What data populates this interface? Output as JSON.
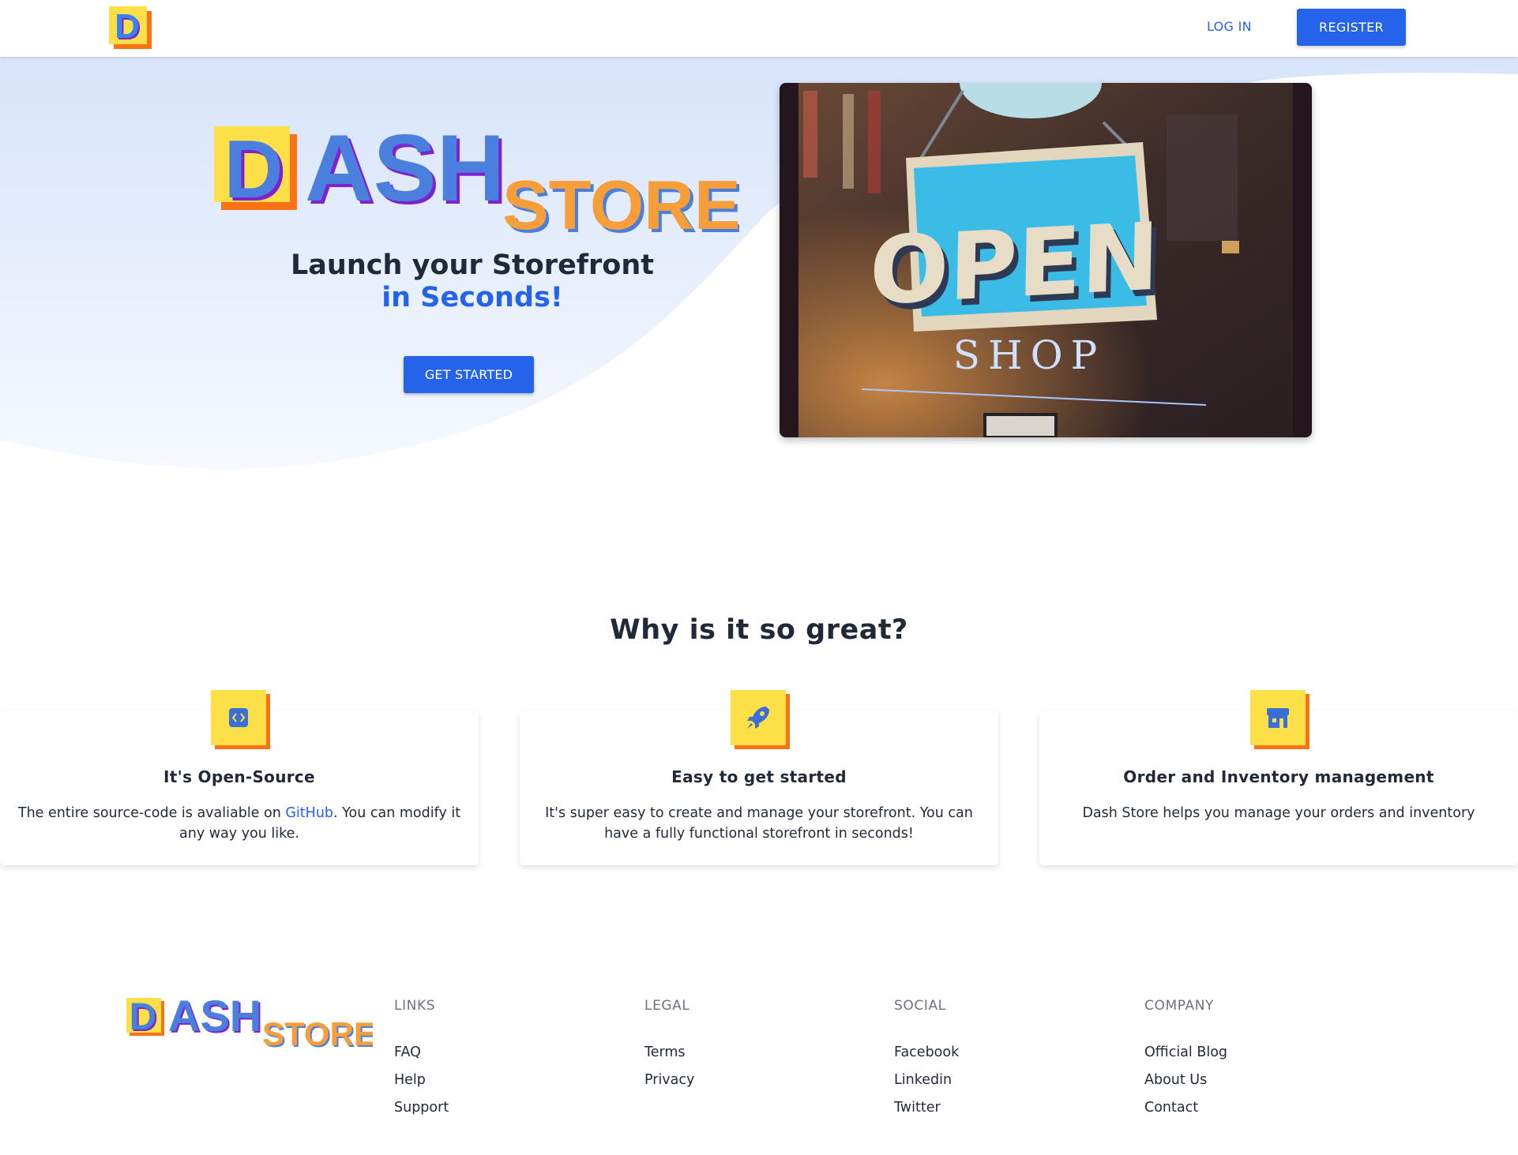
{
  "header": {
    "login_label": "LOG IN",
    "register_label": "REGISTER"
  },
  "logo": {
    "letter": "D",
    "dash_rest": "ASH",
    "store": "STORE"
  },
  "hero": {
    "title_line1": "Launch your Storefront",
    "title_line2": "in Seconds!",
    "cta_label": "GET STARTED",
    "photo_sign_word": "OPEN",
    "photo_sign_sub": "SHOP"
  },
  "features": {
    "title": "Why is it so great?",
    "cards": [
      {
        "icon": "code-icon",
        "title": "It's Open-Source",
        "text_before": "The entire source-code is avaliable on ",
        "link": "GitHub",
        "text_after": ". You can modify it any way you like."
      },
      {
        "icon": "rocket-icon",
        "title": "Easy to get started",
        "text": "It's super easy to create and manage your storefront. You can have a fully functional storefront in seconds!"
      },
      {
        "icon": "store-icon",
        "title": "Order and Inventory management",
        "text": "Dash Store helps you manage your orders and inventory"
      }
    ]
  },
  "footer": {
    "columns": [
      {
        "heading": "LINKS",
        "items": [
          "FAQ",
          "Help",
          "Support"
        ]
      },
      {
        "heading": "LEGAL",
        "items": [
          "Terms",
          "Privacy"
        ]
      },
      {
        "heading": "SOCIAL",
        "items": [
          "Facebook",
          "Linkedin",
          "Twitter"
        ]
      },
      {
        "heading": "COMPANY",
        "items": [
          "Official Blog",
          "About Us",
          "Contact"
        ]
      }
    ]
  },
  "colors": {
    "primary": "#2563eb",
    "logo_yellow": "#fde047",
    "logo_orange": "#f97316",
    "store_orange": "#f59e3a",
    "logo_purple": "#7e22ce",
    "text_dark": "#1f2937",
    "hero_bg": "#dde8fb"
  }
}
